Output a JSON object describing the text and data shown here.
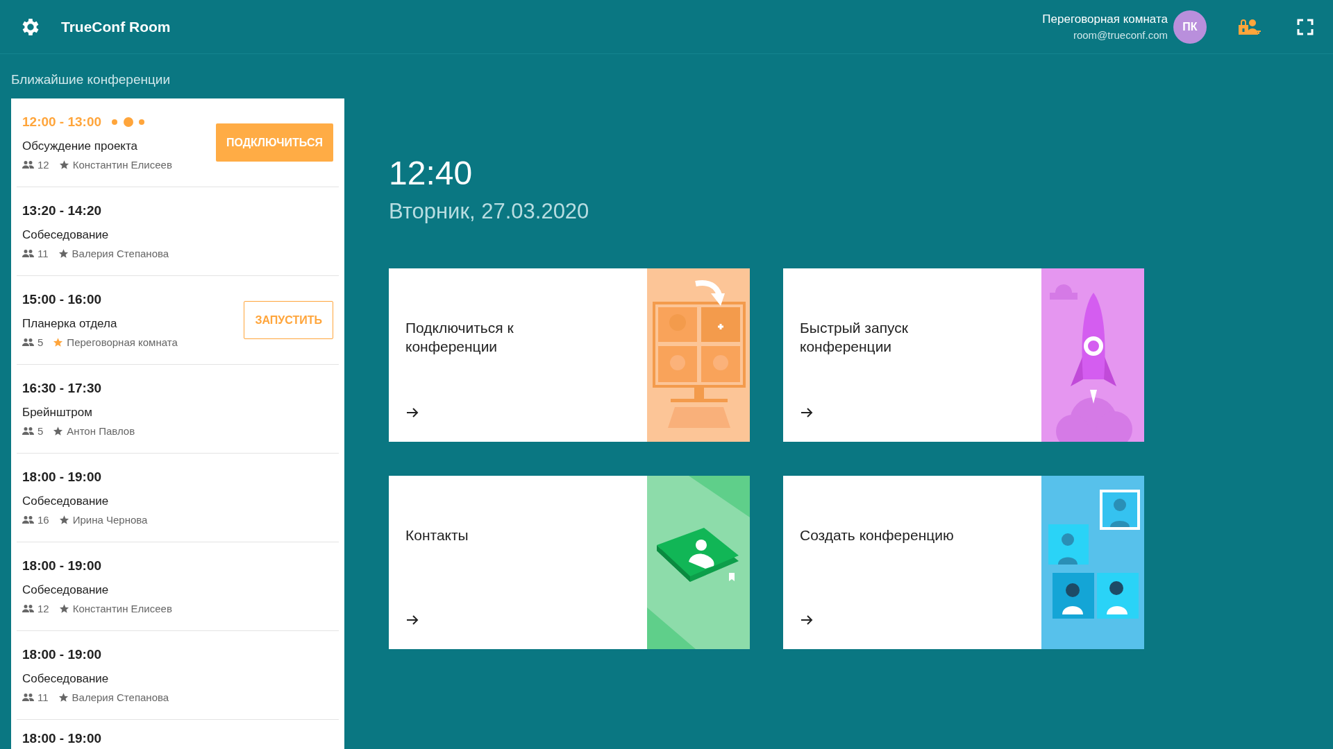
{
  "header": {
    "title": "TrueConf Room",
    "user_name": "Переговорная комната",
    "user_email": "room@trueconf.com",
    "avatar": "ПК"
  },
  "sidebar": {
    "heading": "Ближайшие конференции",
    "meetings": [
      {
        "time": "12:00 - 13:00",
        "title": "Обсуждение проекта",
        "participants": "12",
        "owner": "Константин Елисеев",
        "active": true,
        "owner_highlighted": false,
        "button": {
          "label": "ПОДКЛЮЧИТЬСЯ",
          "kind": "filled"
        }
      },
      {
        "time": "13:20 - 14:20",
        "title": "Собеседование",
        "participants": "11",
        "owner": "Валерия Степанова",
        "active": false,
        "owner_highlighted": false
      },
      {
        "time": "15:00 - 16:00",
        "title": "Планерка отдела",
        "participants": "5",
        "owner": "Переговорная комната",
        "active": false,
        "owner_highlighted": true,
        "button": {
          "label": "ЗАПУСТИТЬ",
          "kind": "outline"
        }
      },
      {
        "time": "16:30 - 17:30",
        "title": "Брейнштром",
        "participants": "5",
        "owner": "Антон Павлов",
        "active": false,
        "owner_highlighted": false
      },
      {
        "time": "18:00 - 19:00",
        "title": "Собеседование",
        "participants": "16",
        "owner": "Ирина Чернова",
        "active": false,
        "owner_highlighted": false
      },
      {
        "time": "18:00 - 19:00",
        "title": "Собеседование",
        "participants": "12",
        "owner": "Константин Елисеев",
        "active": false,
        "owner_highlighted": false
      },
      {
        "time": "18:00 - 19:00",
        "title": "Собеседование",
        "participants": "11",
        "owner": "Валерия Степанова",
        "active": false,
        "owner_highlighted": false
      },
      {
        "time": "18:00 - 19:00",
        "active": false
      }
    ]
  },
  "clock": {
    "time": "12:40",
    "date": "Вторник, 27.03.2020"
  },
  "actions": [
    {
      "label": "Подключиться к конференции",
      "kind": "monitor"
    },
    {
      "label": "Быстрый запуск конференции",
      "kind": "rocket"
    },
    {
      "label": "Контакты",
      "kind": "book"
    },
    {
      "label": "Создать конференцию",
      "kind": "puzzle"
    }
  ]
}
